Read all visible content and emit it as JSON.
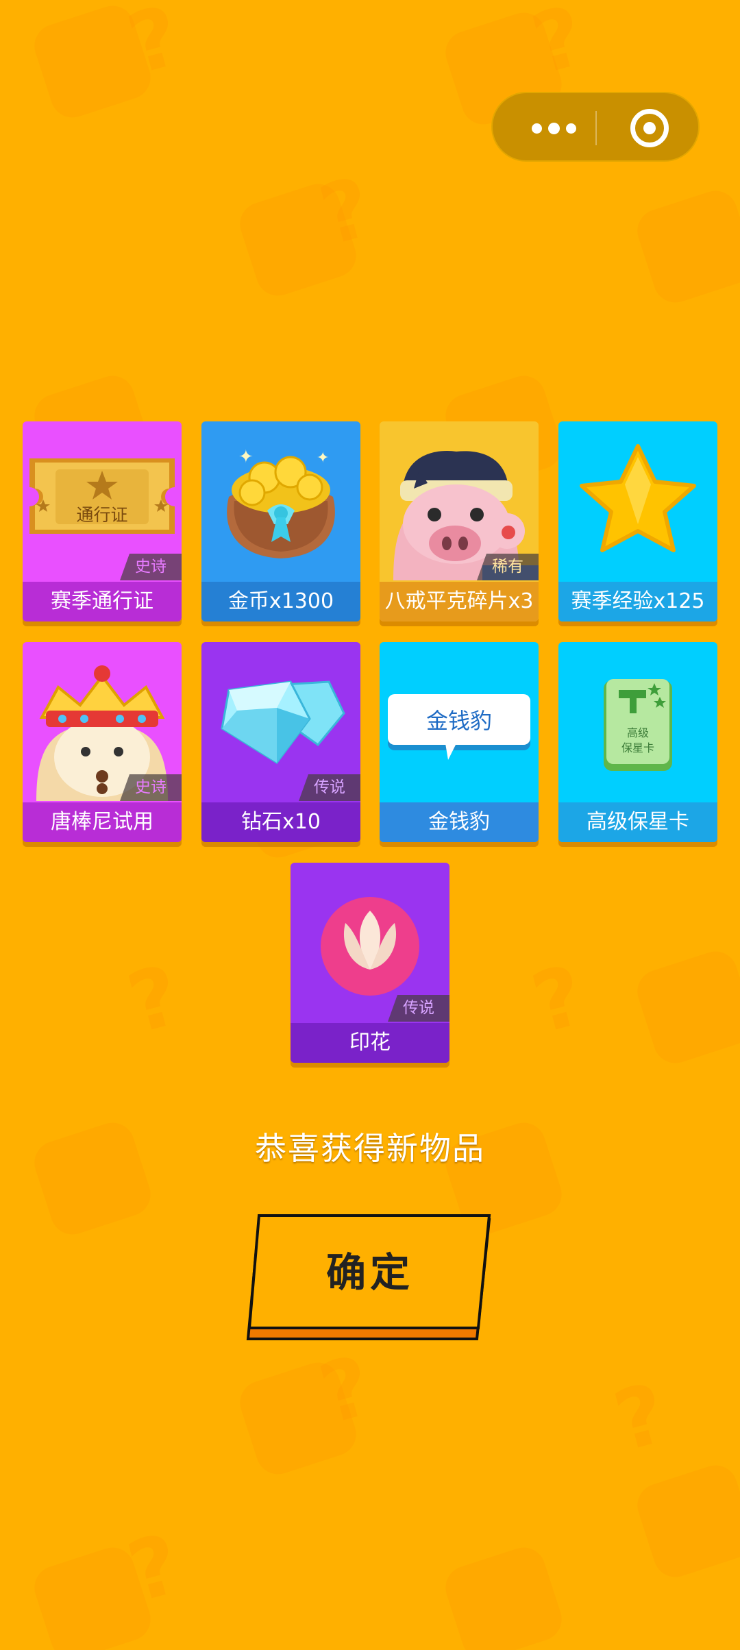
{
  "capsule": {
    "more_icon": "more-dots-icon",
    "close_icon": "target-circle-icon"
  },
  "rewards": [
    {
      "name": "赛季通行证",
      "rarity": "史诗",
      "icon": "season-pass-ticket-icon",
      "art_text": "通行证"
    },
    {
      "name": "金币x1300",
      "rarity": "",
      "icon": "gold-coin-bag-icon"
    },
    {
      "name": "八戒平克碎片x3",
      "rarity": "稀有",
      "icon": "pig-hero-avatar-icon"
    },
    {
      "name": "赛季经验x125",
      "rarity": "",
      "icon": "star-icon"
    },
    {
      "name": "唐棒尼试用",
      "rarity": "史诗",
      "icon": "monk-hero-avatar-icon"
    },
    {
      "name": "钻石x10",
      "rarity": "传说",
      "icon": "diamond-icon"
    },
    {
      "name": "金钱豹",
      "rarity": "",
      "icon": "speech-bubble-icon",
      "art_text": "金钱豹"
    },
    {
      "name": "高级保星卡",
      "rarity": "",
      "icon": "star-protect-card-icon",
      "art_text": "高级\n保星卡"
    },
    {
      "name": "印花",
      "rarity": "传说",
      "icon": "flower-stamp-icon"
    }
  ],
  "caption": "恭喜获得新物品",
  "confirm_label": "确定",
  "colors": {
    "background": "#FFB000",
    "epic": "#E950FF",
    "blue": "#2F9BF2",
    "legend": "#9A34F0",
    "cyan": "#00CFFF",
    "rare_bg": "#F8C52E"
  }
}
